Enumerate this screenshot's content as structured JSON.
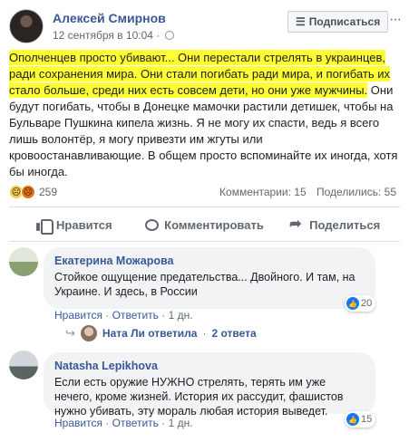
{
  "post": {
    "author": "Алексей Смирнов",
    "date": "12 сентября в 10:04",
    "date_sep": "·",
    "subscribe_label": "Подписаться",
    "subscribe_icon": "☰",
    "more": "···",
    "text_highlighted": "Ополченцев просто убивают... Они перестали стрелять в украинцев, ради сохранения мира. Они стали погибать ради мира, и погибать их стало больше, среди них есть совсем дети, но они уже мужчины.",
    "text_rest": " Они будут погибать, чтобы в Донецке мамочки растили детишек, чтобы на Бульваре Пушкина кипела жизнь. Я не могу их спасти, ведь я всего лишь волонтёр, я могу привезти им жгуты или кровоостанавливающие. В общем просто вспоминайте их иногда, хотя бы иногда.",
    "reactions_count": "259",
    "comments_stat": "Комментарии: 15",
    "shares_stat": "Поделились: 55"
  },
  "actions": {
    "like": "Нравится",
    "comment": "Комментировать",
    "share": "Поделиться"
  },
  "comments": [
    {
      "author": "Екатерина Можарова",
      "text": "Стойкое ощущение предательства... Двойного. И там, на Украине. И здесь, в России",
      "likes": "20",
      "action_like": "Нравится",
      "action_reply": "Ответить",
      "age": "1 дн.",
      "sep": "·",
      "reply_summary": {
        "name": "Ната Ли ответила",
        "sep": "·",
        "count": "2 ответа"
      }
    },
    {
      "author": "Natasha Lepikhova",
      "text": "Если есть оружие НУЖНО стрелять, терять им уже нечего, кроме жизней. История их рассудит, фашистов нужно убивать, эту мораль любая история выведет.",
      "likes": "15",
      "action_like": "Нравится",
      "action_reply": "Ответить",
      "age": "1 дн.",
      "sep": "·"
    }
  ],
  "colors": {
    "link": "#385898",
    "highlight": "#ffff33",
    "like_blue": "#1877f2"
  }
}
